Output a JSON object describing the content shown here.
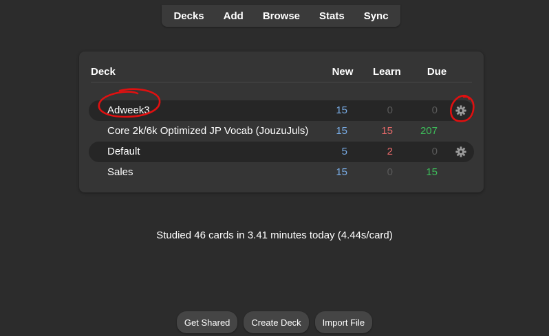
{
  "toolbar": {
    "items": [
      {
        "label": "Decks"
      },
      {
        "label": "Add"
      },
      {
        "label": "Browse"
      },
      {
        "label": "Stats"
      },
      {
        "label": "Sync"
      }
    ]
  },
  "deck_table": {
    "headers": {
      "deck": "Deck",
      "new": "New",
      "learn": "Learn",
      "due": "Due"
    },
    "rows": [
      {
        "name": "Adweek3",
        "new": "15",
        "learn": "0",
        "due": "0",
        "has_gear": true
      },
      {
        "name": "Core 2k/6k Optimized JP Vocab (JouzuJuls)",
        "new": "15",
        "learn": "15",
        "due": "207",
        "has_gear": false
      },
      {
        "name": "Default",
        "new": "5",
        "learn": "2",
        "due": "0",
        "has_gear": true
      },
      {
        "name": "Sales",
        "new": "15",
        "learn": "0",
        "due": "15",
        "has_gear": false
      }
    ]
  },
  "status": {
    "studied_text": "Studied 46 cards in 3.41 minutes today (4.44s/card)"
  },
  "bottom_buttons": {
    "get_shared": "Get Shared",
    "create_deck": "Create Deck",
    "import_file": "Import File"
  },
  "colors": {
    "background": "#2c2c2c",
    "new_count": "#7aaee8",
    "learn_count": "#e86a6a",
    "due_count": "#3dbd5a",
    "zero_count": "#5a5a5a",
    "annotation": "#e01010"
  }
}
